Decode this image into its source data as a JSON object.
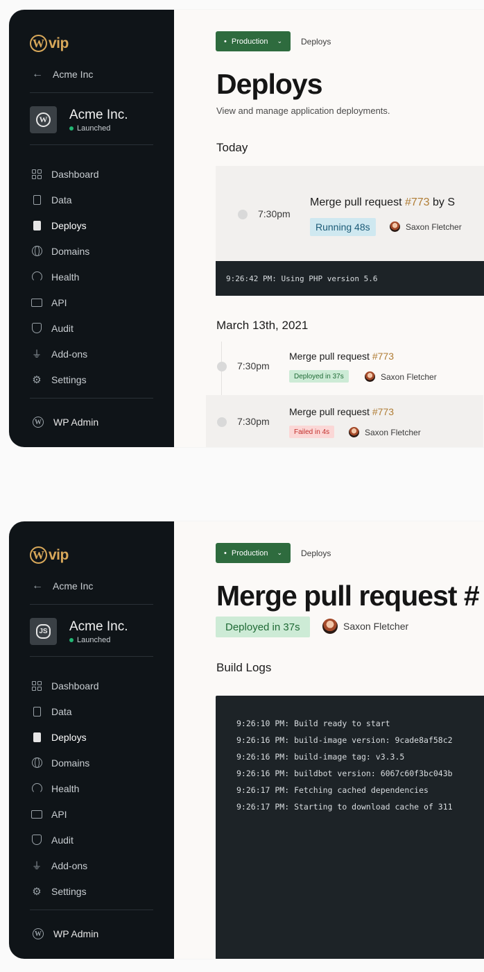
{
  "brand": {
    "logo_text": "vip",
    "logo_letter": "W",
    "accent": "#d8a85a"
  },
  "sidebar": {
    "back_label": "Acme Inc",
    "site_name": "Acme Inc.",
    "site_status": "Launched",
    "site_icon_1": "W",
    "site_icon_2": "JS",
    "items": [
      {
        "label": "Dashboard",
        "icon": "dashboard-icon"
      },
      {
        "label": "Data",
        "icon": "data-icon"
      },
      {
        "label": "Deploys",
        "icon": "deploys-icon"
      },
      {
        "label": "Domains",
        "icon": "globe-icon"
      },
      {
        "label": "Health",
        "icon": "gauge-icon"
      },
      {
        "label": "API",
        "icon": "api-icon"
      },
      {
        "label": "Audit",
        "icon": "shield-icon"
      },
      {
        "label": "Add-ons",
        "icon": "plug-icon"
      },
      {
        "label": "Settings",
        "icon": "gear-icon"
      }
    ],
    "active_item": "Deploys",
    "footer_label": "WP Admin"
  },
  "header": {
    "env_label": "Production",
    "breadcrumb": "Deploys",
    "env_color": "#2e6b3e"
  },
  "deploys_page": {
    "title": "Deploys",
    "subtitle": "View and manage application deployments.",
    "today_heading": "Today",
    "today_item": {
      "time": "7:30pm",
      "title_prefix": "Merge pull request ",
      "pr": "#773",
      "title_suffix": " by S",
      "status": "Running 48s",
      "author": "Saxon Fletcher"
    },
    "log_line": "9:26:42 PM: Using PHP version 5.6",
    "past_heading": "March 13th, 2021",
    "past_items": [
      {
        "time": "7:30pm",
        "title_prefix": "Merge pull request ",
        "pr": "#773",
        "status": "Deployed in 37s",
        "author": "Saxon Fletcher"
      },
      {
        "time": "7:30pm",
        "title_prefix": "Merge pull request ",
        "pr": "#773",
        "status": "Failed in 4s",
        "author": "Saxon Fletcher"
      }
    ]
  },
  "deploy_detail": {
    "title": "Merge pull request #",
    "status": "Deployed in 37s",
    "author": "Saxon Fletcher",
    "build_logs_heading": "Build Logs",
    "logs": [
      "9:26:10 PM: Build ready to start",
      "9:26:16 PM: build-image version: 9cade8af58c2",
      "9:26:16 PM: build-image tag: v3.3.5",
      "9:26:16 PM: buildbot version: 6067c60f3bc043b",
      "9:26:17 PM: Fetching cached dependencies",
      "9:26:17 PM: Starting to download cache of 311"
    ]
  }
}
